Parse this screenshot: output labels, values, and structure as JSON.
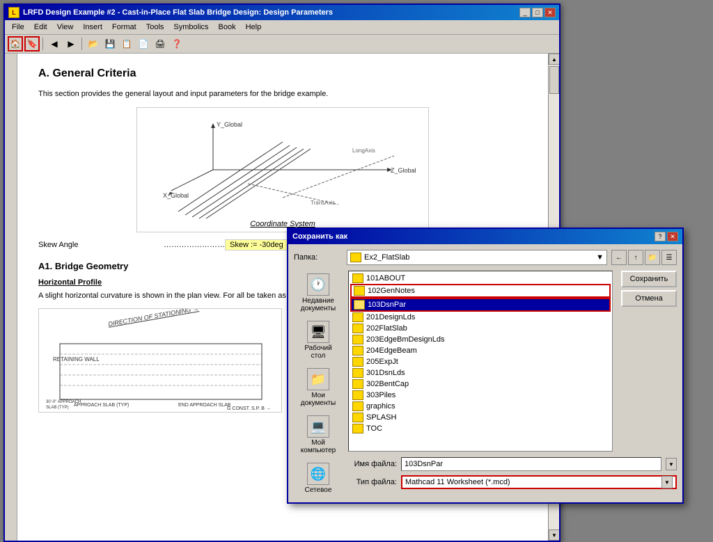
{
  "window": {
    "title": "LRFD Design Example #2 - Cast-in-Place Flat Slab Bridge Design: Design Parameters",
    "icon": "L"
  },
  "menu": {
    "items": [
      "File",
      "Edit",
      "View",
      "Insert",
      "Format",
      "Tools",
      "Symbolics",
      "Book",
      "Help"
    ]
  },
  "toolbar": {
    "buttons": [
      "🏠",
      "🔖",
      "←",
      "→",
      "📁",
      "💾",
      "📋",
      "📄",
      "🖨",
      "❓"
    ]
  },
  "document": {
    "heading": "A. General Criteria",
    "paragraph1": "This section provides the general layout and input parameters for the bridge example.",
    "coord_label": "Coordinate System",
    "skew_label": "Skew Angle",
    "skew_dots": "…………………………",
    "skew_value": "Skew := -30deg",
    "subheading1": "A1. Bridge Geometry",
    "subsubheading1": "Horizontal Profile",
    "paragraph2": "A slight horizontal curvature is shown in the plan view.  For all  be taken as zero."
  },
  "dialog": {
    "title": "Сохранить как",
    "folder_label": "Папка:",
    "folder_name": "Ex2_FlatSlab",
    "left_panel": [
      {
        "label": "Недавние документы",
        "icon": "🕐"
      },
      {
        "label": "Рабочий стол",
        "icon": "🖥"
      },
      {
        "label": "Мои документы",
        "icon": "📁"
      },
      {
        "label": "Мой компьютер",
        "icon": "💻"
      },
      {
        "label": "Сетевое",
        "icon": "🌐"
      }
    ],
    "files": [
      {
        "name": "101ABOUT",
        "type": "folder"
      },
      {
        "name": "102GenNotes",
        "type": "folder"
      },
      {
        "name": "103DsnPar",
        "type": "folder",
        "selected": true,
        "highlighted": true
      },
      {
        "name": "201DesignLds",
        "type": "folder"
      },
      {
        "name": "202FlatSlab",
        "type": "folder"
      },
      {
        "name": "203EdgeBmDesignLds",
        "type": "folder"
      },
      {
        "name": "204EdgeBeam",
        "type": "folder"
      },
      {
        "name": "205ExpJt",
        "type": "folder"
      },
      {
        "name": "301DsnLds",
        "type": "folder"
      },
      {
        "name": "302BentCap",
        "type": "folder"
      },
      {
        "name": "303Piles",
        "type": "folder"
      },
      {
        "name": "graphics",
        "type": "folder"
      },
      {
        "name": "SPLASH",
        "type": "folder"
      },
      {
        "name": "TOC",
        "type": "folder"
      }
    ],
    "filename_label": "Имя файла:",
    "filename_value": "103DsnPar",
    "filetype_label": "Тип файла:",
    "filetype_value": "Mathcad 11 Worksheet (*.mcd)",
    "save_btn": "Сохранить",
    "cancel_btn": "Отмена"
  }
}
